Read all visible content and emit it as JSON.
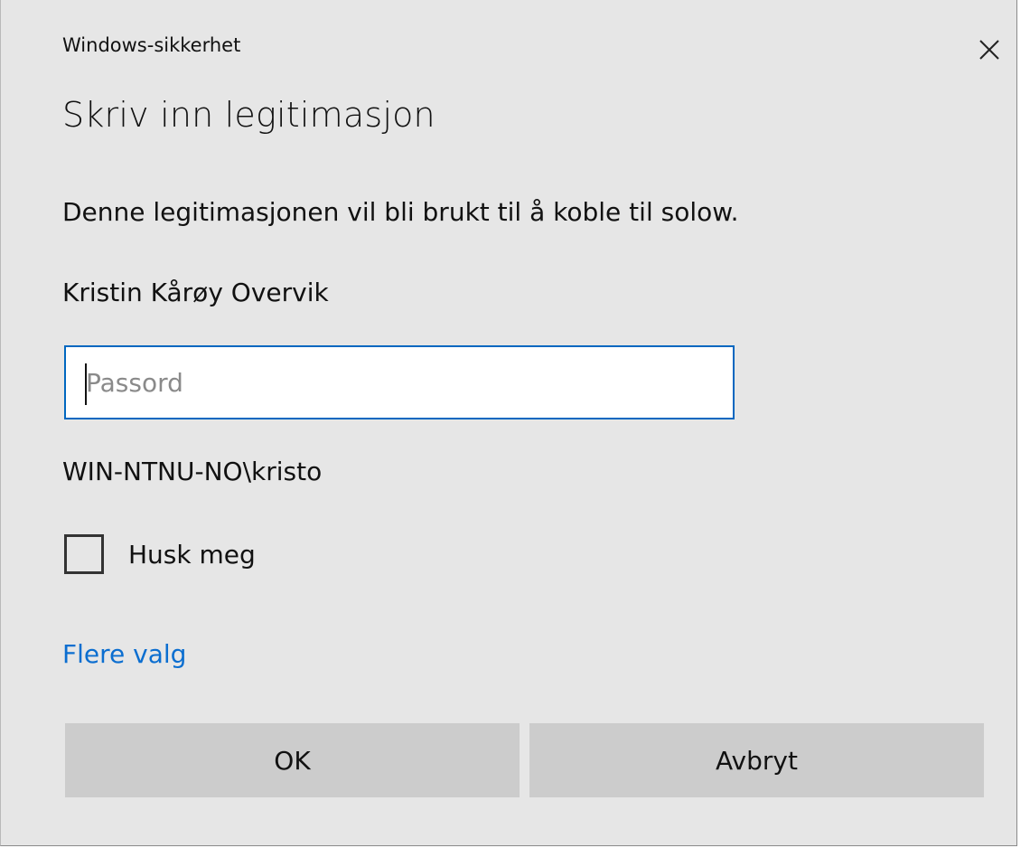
{
  "dialog": {
    "window_title": "Windows-sikkerhet",
    "heading": "Skriv inn legitimasjon",
    "description": "Denne legitimasjonen vil bli brukt til å koble til solow.",
    "username": "Kristin Kårøy Overvik",
    "password": {
      "value": "",
      "placeholder": "Passord"
    },
    "domain_user": "WIN-NTNU-NO\\kristo",
    "remember": {
      "label": "Husk meg",
      "checked": false
    },
    "more_options_label": "Flere valg",
    "buttons": {
      "ok_label": "OK",
      "cancel_label": "Avbryt"
    },
    "icons": {
      "close": "close-icon"
    },
    "colors": {
      "background": "#e6e6e6",
      "accent": "#0067c0",
      "link": "#0b6ed0",
      "button": "#cccccc"
    }
  }
}
